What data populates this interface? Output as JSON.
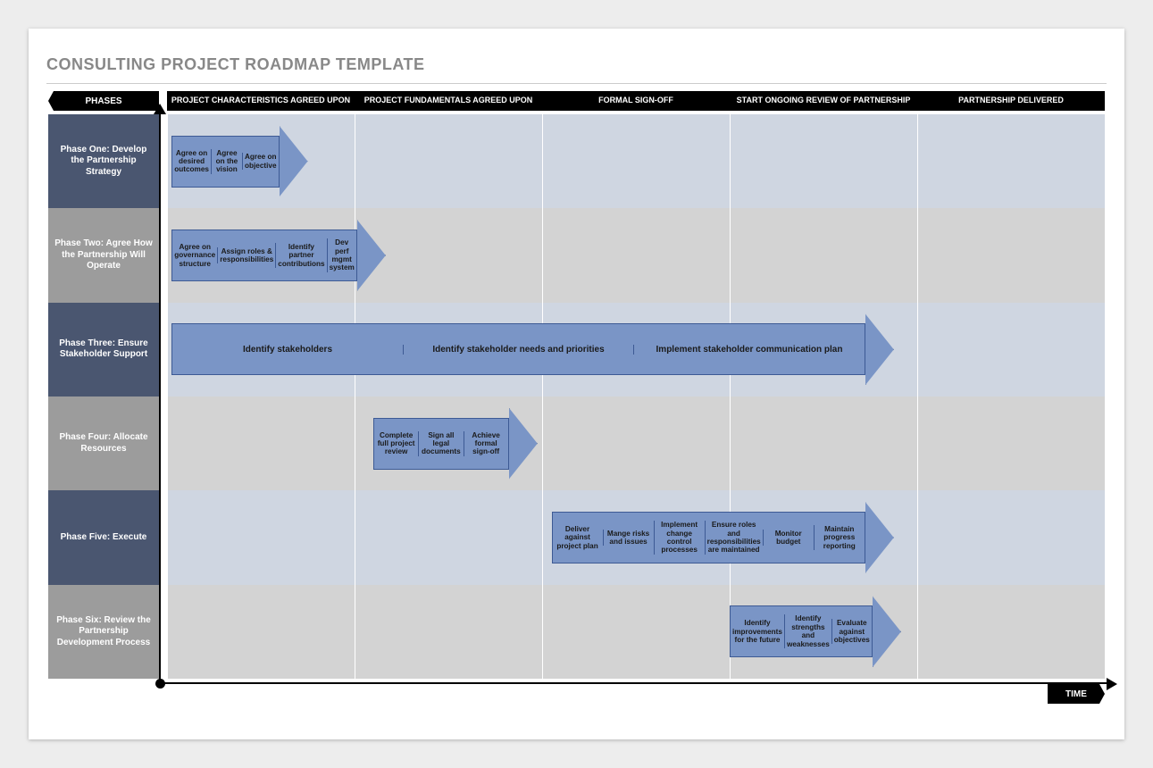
{
  "title": "CONSULTING PROJECT ROADMAP TEMPLATE",
  "axis": {
    "y": "PHASES",
    "x": "TIME"
  },
  "columns": [
    "PROJECT CHARACTERISTICS AGREED UPON",
    "PROJECT FUNDAMENTALS AGREED UPON",
    "FORMAL SIGN-OFF",
    "START ONGOING REVIEW OF PARTNERSHIP",
    "PARTNERSHIP DELIVERED"
  ],
  "phases": [
    {
      "label": "Phase One: Develop the Partnership Strategy"
    },
    {
      "label": "Phase Two: Agree How the Partnership Will Operate"
    },
    {
      "label": "Phase Three: Ensure Stakeholder Support"
    },
    {
      "label": "Phase Four: Allocate Resources"
    },
    {
      "label": "Phase Five: Execute"
    },
    {
      "label": "Phase Six: Review the Partnership Development Process"
    }
  ],
  "arrows": [
    {
      "row": 0,
      "start_pct": 0.5,
      "end_pct": 15,
      "wide": false,
      "segs": [
        "Agree on desired outcomes",
        "Agree on the vision",
        "Agree on objective"
      ]
    },
    {
      "row": 1,
      "start_pct": 0.5,
      "end_pct": 20.5,
      "wide": false,
      "segs": [
        "Agree on governance structure",
        "Assign roles & responsibilities",
        "Identify partner contributions",
        "Dev perf mgmt system"
      ]
    },
    {
      "row": 2,
      "start_pct": 0.5,
      "end_pct": 77.5,
      "wide": true,
      "segs": [
        "Identify stakeholders",
        "Identify stakeholder needs and priorities",
        "Implement stakeholder communication plan"
      ]
    },
    {
      "row": 3,
      "start_pct": 22,
      "end_pct": 39.5,
      "wide": false,
      "segs": [
        "Complete full project review",
        "Sign all legal documents",
        "Achieve formal sign-off"
      ]
    },
    {
      "row": 4,
      "start_pct": 41,
      "end_pct": 77.5,
      "wide": false,
      "segs": [
        "Deliver against project plan",
        "Mange risks and issues",
        "Implement change control processes",
        "Ensure roles and responsibilities are maintained",
        "Monitor budget",
        "Maintain progress reporting"
      ]
    },
    {
      "row": 5,
      "start_pct": 60,
      "end_pct": 77.5,
      "wide": false,
      "segs": [
        "Identify improvements for the future",
        "Identify strengths and weaknesses",
        "Evaluate against objectives"
      ]
    }
  ]
}
